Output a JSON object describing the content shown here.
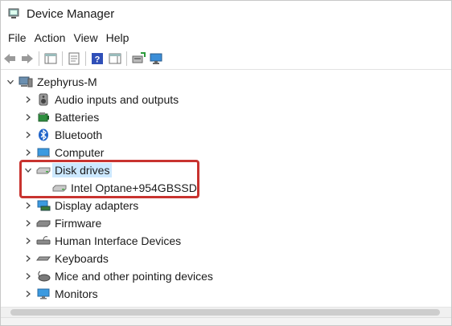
{
  "window": {
    "title": "Device Manager"
  },
  "menu": [
    "File",
    "Action",
    "View",
    "Help"
  ],
  "toolbar": [
    "back-icon",
    "forward-icon",
    "show-hide-console-tree-icon",
    "properties-icon",
    "help-icon",
    "action-pane-icon",
    "update-driver-icon",
    "scan-hardware-icon"
  ],
  "tree": {
    "root": "Zephyrus-M",
    "categories": [
      {
        "label": "Audio inputs and outputs",
        "icon": "speaker-icon",
        "expanded": false
      },
      {
        "label": "Batteries",
        "icon": "battery-icon",
        "expanded": false
      },
      {
        "label": "Bluetooth",
        "icon": "bluetooth-icon",
        "expanded": false
      },
      {
        "label": "Computer",
        "icon": "computer-icon",
        "expanded": false
      },
      {
        "label": "Disk drives",
        "icon": "disk-drive-icon",
        "expanded": true,
        "selected": true,
        "children": [
          {
            "label": "Intel Optane+954GBSSD",
            "icon": "disk-drive-icon"
          }
        ]
      },
      {
        "label": "Display adapters",
        "icon": "display-adapter-icon",
        "expanded": false
      },
      {
        "label": "Firmware",
        "icon": "firmware-icon",
        "expanded": false
      },
      {
        "label": "Human Interface Devices",
        "icon": "hid-icon",
        "expanded": false
      },
      {
        "label": "Keyboards",
        "icon": "keyboard-icon",
        "expanded": false
      },
      {
        "label": "Mice and other pointing devices",
        "icon": "mouse-icon",
        "expanded": false
      },
      {
        "label": "Monitors",
        "icon": "monitor-icon",
        "expanded": false
      }
    ]
  },
  "colors": {
    "selection": "#cce8ff",
    "highlight_border": "#c8332f"
  }
}
